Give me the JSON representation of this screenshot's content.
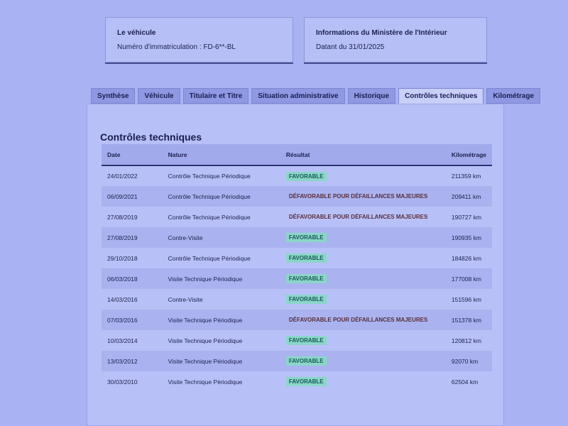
{
  "vehicle_card": {
    "title": "Le véhicule",
    "registration": "Numéro d'immatriculation : FD-6**-BL"
  },
  "ministry_card": {
    "title": "Informations du Ministère de l'Intérieur",
    "date": "Datant du 31/01/2025"
  },
  "tabs": [
    {
      "label": "Synthèse"
    },
    {
      "label": "Véhicule"
    },
    {
      "label": "Titulaire et Titre"
    },
    {
      "label": "Situation administrative"
    },
    {
      "label": "Historique"
    },
    {
      "label": "Contrôles techniques"
    },
    {
      "label": "Kilométrage"
    }
  ],
  "active_tab": "Contrôles techniques",
  "section": {
    "title": "Contrôles techniques",
    "columns": {
      "date": "Date",
      "nature": "Nature",
      "result": "Résultat",
      "km": "Kilométrage"
    },
    "rows": [
      {
        "date": "24/01/2022",
        "nature": "Contrôle Technique Périodique",
        "result": "FAVORABLE",
        "km": "211359 km"
      },
      {
        "date": "06/09/2021",
        "nature": "Contrôle Technique Périodique",
        "result": "DÉFAVORABLE POUR DÉFAILLANCES MAJEURES",
        "km": "209411 km"
      },
      {
        "date": "27/08/2019",
        "nature": "Contrôle Technique Périodique",
        "result": "DÉFAVORABLE POUR DÉFAILLANCES MAJEURES",
        "km": "190727 km"
      },
      {
        "date": "27/08/2019",
        "nature": "Contre-Visite",
        "result": "FAVORABLE",
        "km": "190935 km"
      },
      {
        "date": "29/10/2018",
        "nature": "Contrôle Technique Périodique",
        "result": "FAVORABLE",
        "km": "184826 km"
      },
      {
        "date": "06/03/2018",
        "nature": "Visite Technique Périodique",
        "result": "FAVORABLE",
        "km": "177008 km"
      },
      {
        "date": "14/03/2016",
        "nature": "Contre-Visite",
        "result": "FAVORABLE",
        "km": "151596 km"
      },
      {
        "date": "07/03/2016",
        "nature": "Visite Technique Périodique",
        "result": "DÉFAVORABLE POUR DÉFAILLANCES MAJEURES",
        "km": "151378 km"
      },
      {
        "date": "10/03/2014",
        "nature": "Visite Technique Périodique",
        "result": "FAVORABLE",
        "km": "120812 km"
      },
      {
        "date": "13/03/2012",
        "nature": "Visite Technique Périodique",
        "result": "FAVORABLE",
        "km": "92070 km"
      },
      {
        "date": "30/03/2010",
        "nature": "Visite Technique Périodique",
        "result": "FAVORABLE",
        "km": "62504 km"
      }
    ]
  },
  "colors": {
    "favorable_bg": "#8ad6c9",
    "favorable_text": "#1a5a58",
    "defavorable_text": "#5a2d3a"
  }
}
